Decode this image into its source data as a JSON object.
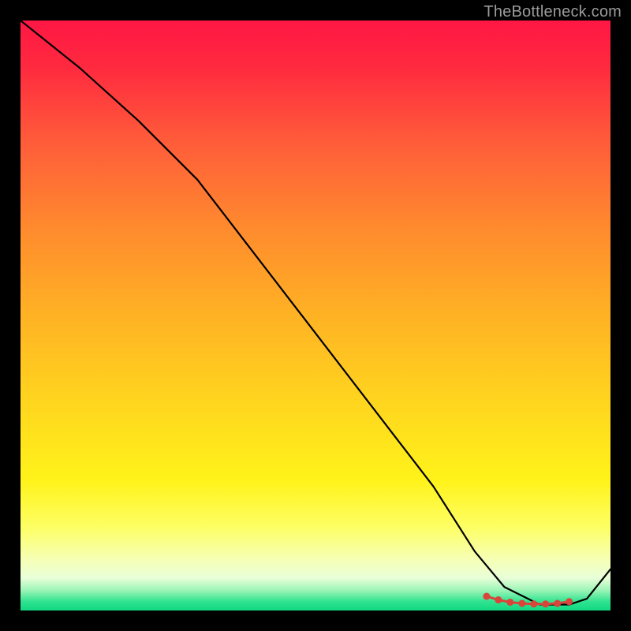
{
  "attribution": "TheBottleneck.com",
  "chart_data": {
    "type": "line",
    "title": "",
    "xlabel": "",
    "ylabel": "",
    "xlim": [
      0,
      100
    ],
    "ylim": [
      0,
      100
    ],
    "background_gradient_stops": [
      {
        "offset": 0.0,
        "color": "#ff1744"
      },
      {
        "offset": 0.08,
        "color": "#ff2a3f"
      },
      {
        "offset": 0.2,
        "color": "#ff5a3a"
      },
      {
        "offset": 0.35,
        "color": "#ff8a2e"
      },
      {
        "offset": 0.5,
        "color": "#ffb224"
      },
      {
        "offset": 0.65,
        "color": "#ffd61e"
      },
      {
        "offset": 0.78,
        "color": "#fff31a"
      },
      {
        "offset": 0.86,
        "color": "#fdff66"
      },
      {
        "offset": 0.91,
        "color": "#f7ffb0"
      },
      {
        "offset": 0.945,
        "color": "#e8ffd8"
      },
      {
        "offset": 0.965,
        "color": "#9ff5b8"
      },
      {
        "offset": 0.985,
        "color": "#2fe38f"
      },
      {
        "offset": 1.0,
        "color": "#12d882"
      }
    ],
    "series": [
      {
        "name": "bottleneck-curve",
        "color": "#000000",
        "x": [
          0,
          10,
          20,
          30,
          40,
          50,
          60,
          70,
          77,
          82,
          88,
          93,
          96,
          100
        ],
        "y": [
          100,
          92,
          83,
          73,
          60,
          47,
          34,
          21,
          10,
          4,
          1,
          1,
          2,
          7
        ]
      }
    ],
    "markers": {
      "name": "optimal-range",
      "color": "#d9453a",
      "points": [
        {
          "x": 79,
          "y": 2.4
        },
        {
          "x": 81,
          "y": 1.8
        },
        {
          "x": 83,
          "y": 1.4
        },
        {
          "x": 85,
          "y": 1.2
        },
        {
          "x": 87,
          "y": 1.1
        },
        {
          "x": 89,
          "y": 1.1
        },
        {
          "x": 91,
          "y": 1.2
        },
        {
          "x": 93,
          "y": 1.5
        }
      ]
    }
  }
}
